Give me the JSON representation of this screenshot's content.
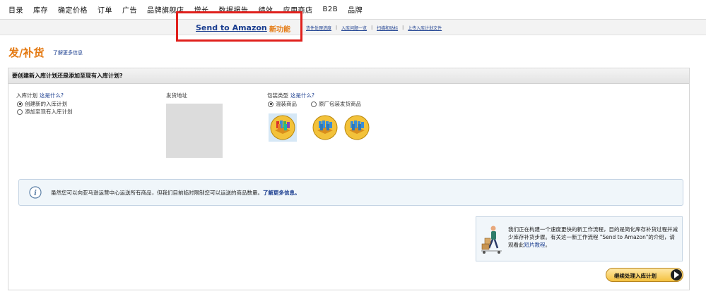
{
  "topnav": {
    "items": [
      "目录",
      "库存",
      "确定价格",
      "订单",
      "广告",
      "品牌旗舰店",
      "增长",
      "数据报告",
      "绩效",
      "应用商店",
      "B2B",
      "品牌"
    ]
  },
  "subnav": {
    "send_to_amazon": "Send to Amazon",
    "new_feature": "新功能",
    "links": [
      "货件处理进度",
      "入库问题一览",
      "扫描和贴标",
      "上传入库计划文件"
    ],
    "separator": "|"
  },
  "page": {
    "title": "发/补货",
    "learn_more": "了解更多信息"
  },
  "panel": {
    "header": "要创建新入库计划还是添加至现有入库计划?",
    "plan_label": "入库计划",
    "plan_help": "这是什么?",
    "plan_options": [
      "创建新的入库计划",
      "添加至现有入库计划"
    ],
    "address_label": "发货地址",
    "packing_label": "包装类型",
    "packing_help": "这是什么?",
    "packing_options": [
      "混装商品",
      "原厂包装发货商品"
    ],
    "info_text": "虽然您可以向亚马逊运营中心运送所有商品，但我们目前临时限制您可以运送的商品数量。",
    "info_link": "了解更多信息。",
    "promo_text": "我们正在构建一个速度更快的新工作流程，目的是简化库存补货过程并减少库存补货步骤。有关这一新工作流程 \"Send to Amazon\"的介绍，请观看此",
    "promo_link": "短片教程",
    "promo_end": "。",
    "continue_label": "继续处理入库计划"
  },
  "colors": {
    "accent_orange": "#e47911",
    "link_blue": "#1a3d8f",
    "highlight_red": "#e0201c",
    "button_yellow": "#f4c13f"
  },
  "icons": [
    "info-icon",
    "mixed-pack-icon",
    "case-pack-icon",
    "worker-boxes-illustration",
    "arrow-right-icon"
  ]
}
